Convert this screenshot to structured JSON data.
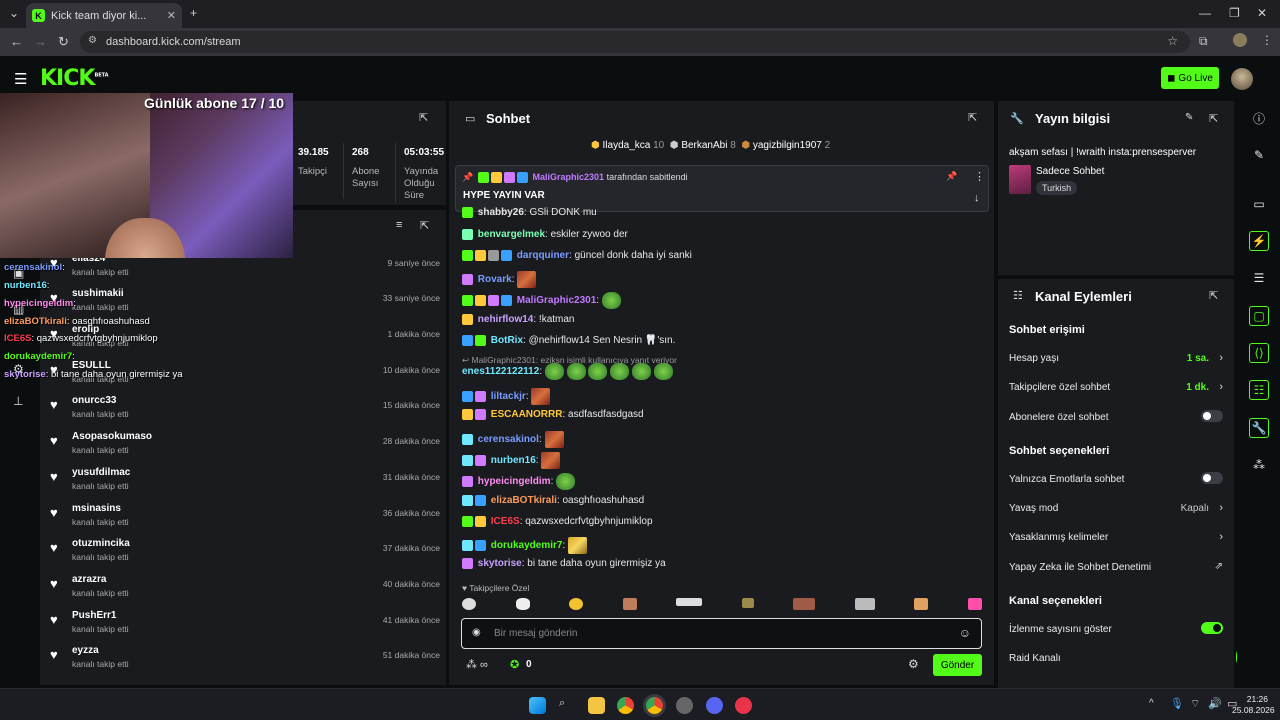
{
  "browser": {
    "tab_title": "Kick team diyor ki...",
    "url": "dashboard.kick.com/stream"
  },
  "header": {
    "logo": "KICK",
    "logo_tag": "BETA",
    "go_live": "Go Live"
  },
  "overlay": {
    "sub_goal": "Günlük abone 17 / 10",
    "lines": [
      {
        "user": "cerensakinol",
        "text": ":",
        "color": "#7b9cff"
      },
      {
        "user": "nurben16",
        "text": ":",
        "color": "#6ee7ff"
      },
      {
        "user": "hypeicingeldim",
        "text": ":",
        "color": "#ff8cf0"
      },
      {
        "user": "elizaBOTkirali",
        "text": ": oasghfıoashuhasd",
        "color": "#ff9b5c"
      },
      {
        "user": "ICE6S",
        "text": ": qazwsxedcrfvtgbyhnjumiklop",
        "color": "#ff3d4d"
      },
      {
        "user": "dorukaydemir7",
        "text": ":",
        "color": "#53fc18"
      },
      {
        "user": "skytorise",
        "text": ": bi tane daha oyun girermişiz ya",
        "color": "#c9a0ff"
      }
    ]
  },
  "stats": [
    {
      "value": "39.185",
      "label": "Takipçi"
    },
    {
      "value": "268",
      "label": "Abone Sayısı"
    },
    {
      "value": "05:03:55",
      "label": "Yayında Olduğu Süre"
    }
  ],
  "follows": {
    "sub": "kanalı takip etti",
    "rows": [
      {
        "name": "elias24",
        "time": "9 saniye önce"
      },
      {
        "name": "sushimakii",
        "time": "33 saniye önce"
      },
      {
        "name": "erollp",
        "time": "1 dakika önce"
      },
      {
        "name": "ESULLL",
        "time": "10 dakika önce"
      },
      {
        "name": "onurcc33",
        "time": "15 dakika önce"
      },
      {
        "name": "Asopasokumaso",
        "time": "28 dakika önce"
      },
      {
        "name": "yusufdilmac",
        "time": "31 dakika önce"
      },
      {
        "name": "msinasins",
        "time": "36 dakika önce"
      },
      {
        "name": "otuzmincika",
        "time": "37 dakika önce"
      },
      {
        "name": "azrazra",
        "time": "40 dakika önce"
      },
      {
        "name": "PushErr1",
        "time": "41 dakika önce"
      },
      {
        "name": "eyzza",
        "time": "51 dakika önce"
      }
    ]
  },
  "chat": {
    "title": "Sohbet",
    "top_gifters": [
      {
        "name": "Ilayda_kca",
        "count": "10"
      },
      {
        "name": "BerkanAbi",
        "count": "8"
      },
      {
        "name": "yagizbilgin1907",
        "count": "2"
      }
    ],
    "pinned_by": "MaliGraphic2301",
    "pinned_by_suffix": "tarafından sabitlendi",
    "pinned_text": "HYPE YAYIN VAR",
    "messages": [
      {
        "user": "shabby26",
        "text": ": GSli DONK mu",
        "color": "#e6e6e6"
      },
      {
        "user": "benvargelmek",
        "text": ": eskiler zywoo der",
        "color": "#7bffb4"
      },
      {
        "user": "darqquiner",
        "text": ": güncel donk daha iyi sanki",
        "color": "#7b9cff"
      },
      {
        "user": "Rovark",
        "text": ":",
        "color": "#7b9cff"
      },
      {
        "user": "MaliGraphic2301",
        "text": ":",
        "color": "#c07bff"
      },
      {
        "user": "nehirflow14",
        "text": ": !katman",
        "color": "#c9a0ff"
      },
      {
        "user": "BotRix",
        "text": ": @nehirflow14 Sen Nesrin 🦷'sın.",
        "color": "#6ee7ff"
      },
      {
        "user": "enes1122122112",
        "text": ":",
        "color": "#6ee7ff"
      },
      {
        "user": "liltackjr",
        "text": ":",
        "color": "#7b9cff"
      },
      {
        "user": "ESCAANORRR",
        "text": ": asdfasdfasdgasd",
        "color": "#ffc83d"
      },
      {
        "user": "cerensakinol",
        "text": ":",
        "color": "#7b9cff"
      },
      {
        "user": "nurben16",
        "text": ":",
        "color": "#6ee7ff"
      },
      {
        "user": "hypeicingeldim",
        "text": ":",
        "color": "#ff8cf0"
      },
      {
        "user": "elizaBOTkirali",
        "text": ": oasghfıoashuhasd",
        "color": "#ff9b5c"
      },
      {
        "user": "ICE6S",
        "text": ": qazwsxedcrfvtgbyhnjumiklop",
        "color": "#ff3d4d"
      },
      {
        "user": "dorukaydemir7",
        "text": ":",
        "color": "#53fc18"
      },
      {
        "user": "skytorise",
        "text": ": bi tane daha oyun girermişiz ya",
        "color": "#c9a0ff"
      }
    ],
    "reply_note": "MaliGraphic2301: eziksn isimli kullanıcıya yanıt veriyor",
    "followers_only": "Takipçilere Özel",
    "input_placeholder": "Bir mesaj gönderin",
    "points": "0",
    "send": "Gönder"
  },
  "info": {
    "title": "Yayın bilgisi",
    "stream_title": "akşam sefası | !wraith insta:prensesperver",
    "category": "Sadece Sohbet",
    "language": "Turkish"
  },
  "actions": {
    "title": "Kanal Eylemleri",
    "chat_access": "Sohbet erişimi",
    "account_age": "Hesap yaşı",
    "account_age_val": "1 sa.",
    "followers_chat": "Takipçilere özel sohbet",
    "followers_chat_val": "1 dk.",
    "subs_chat": "Abonelere özel sohbet",
    "chat_options": "Sohbet seçenekleri",
    "emote_only": "Yalnızca Emotlarla sohbet",
    "slow_mode": "Yavaş mod",
    "slow_mode_val": "Kapalı",
    "banned_words": "Yasaklanmış kelimeler",
    "ai_moderation": "Yapay Zeka ile Sohbet Denetimi",
    "channel_options": "Kanal seçenekleri",
    "show_viewers": "İzlenme sayısını göster",
    "raid": "Raid Kanalı"
  },
  "taskbar": {
    "time": "21:26",
    "date": "25.08.2026"
  },
  "notify_badge": "1"
}
